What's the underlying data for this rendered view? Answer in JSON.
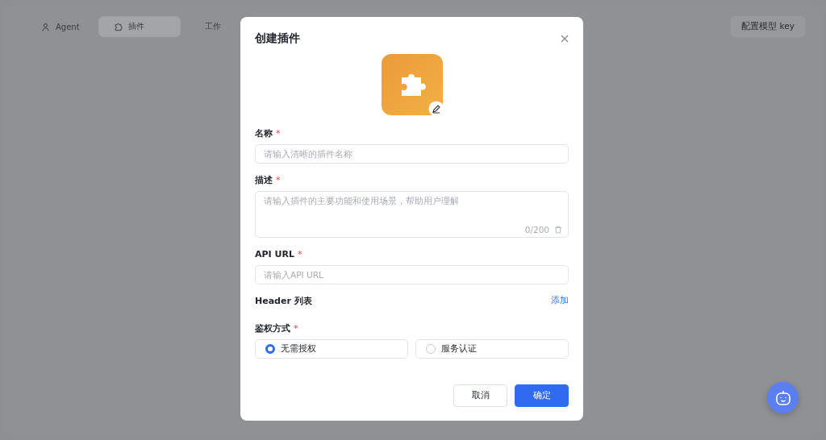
{
  "nav": {
    "tabs": [
      {
        "label": "Agent",
        "selected": false
      },
      {
        "label": "插件",
        "selected": true
      },
      {
        "label": "工作",
        "selected": false
      }
    ],
    "config_button": "配置模型 key"
  },
  "dialog": {
    "title": "创建插件",
    "fields": [
      {
        "kind": "input",
        "label": "名称",
        "mark": "*",
        "placeholder": "请输入清晰的插件名称"
      },
      {
        "kind": "textarea",
        "label": "描述",
        "mark": "*",
        "placeholder": "请输入插件的主要功能和使用场景，帮助用户理解",
        "counter": "0/200"
      },
      {
        "kind": "input",
        "label": "API URL",
        "mark": "*",
        "placeholder": "请输入API URL"
      },
      {
        "kind": "header",
        "label": "Header 列表",
        "action": "添加"
      },
      {
        "kind": "radio",
        "label": "鉴权方式",
        "mark": "*",
        "options": [
          {
            "label": "无需授权",
            "selected": true
          },
          {
            "label": "服务认证",
            "selected": false
          }
        ]
      }
    ],
    "buttons": [
      {
        "label": "取消",
        "kind": "secondary"
      },
      {
        "label": "确定",
        "kind": "primary"
      }
    ]
  }
}
